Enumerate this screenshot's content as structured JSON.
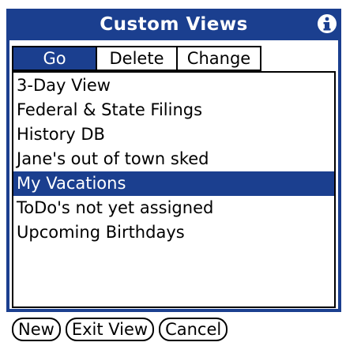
{
  "title": "Custom Views",
  "colors": {
    "accent": "#1b3f8f",
    "background": "#ffffff",
    "text": "#000000"
  },
  "title_bar": {
    "info_icon": "info-icon"
  },
  "tabs": [
    {
      "label": "Go",
      "selected": true
    },
    {
      "label": "Delete",
      "selected": false
    },
    {
      "label": "Change",
      "selected": false
    }
  ],
  "views": [
    {
      "label": "3-Day View",
      "selected": false
    },
    {
      "label": "Federal & State Filings",
      "selected": false
    },
    {
      "label": "History DB",
      "selected": false
    },
    {
      "label": "Jane's out of town sked",
      "selected": false
    },
    {
      "label": "My Vacations",
      "selected": true
    },
    {
      "label": "ToDo's not yet assigned",
      "selected": false
    },
    {
      "label": "Upcoming Birthdays",
      "selected": false
    }
  ],
  "buttons": [
    {
      "label": "New"
    },
    {
      "label": "Exit View"
    },
    {
      "label": "Cancel"
    }
  ]
}
